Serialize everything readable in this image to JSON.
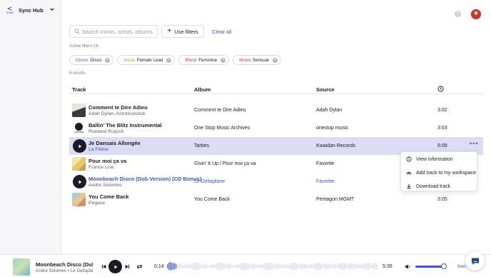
{
  "app": {
    "brand_small": "SYNC",
    "brand_name": "Sync Hub"
  },
  "search": {
    "placeholder": "Search tracks, artists, albums..."
  },
  "filters": {
    "use_filters_label": "Use filters",
    "clear_label": "Clear all",
    "active_label": "Active filters (4)"
  },
  "chips": [
    {
      "category": "Genre",
      "value": "Disco"
    },
    {
      "category": "Vocal",
      "value": "Female Lead"
    },
    {
      "category": "Mood",
      "value": "Feminine"
    },
    {
      "category": "Mood",
      "value": "Sensual"
    }
  ],
  "results_label": "6 results",
  "table": {
    "headers": {
      "track": "Track",
      "album": "Album",
      "source": "Source"
    },
    "rows": [
      {
        "title": "Comment te Dire Adieu",
        "artist": "Adah Dylan, Astroloveclub",
        "album": "Comment te Dire Adieu",
        "source": "Adah Dylan",
        "duration": "3:02"
      },
      {
        "title": "Ballin' The Blitz Instrumental",
        "artist": "Roeland Ruijsch",
        "album": "One Stop Music Archives",
        "source": "onestop music",
        "duration": "3:03",
        "thumb_text": "onestop"
      },
      {
        "title": "Je Dansais Allongée",
        "artist": "La Féline",
        "album": "Tarbes",
        "source": "Kwaidan Records",
        "duration": "5:09",
        "more": "•••"
      },
      {
        "title": "Pour moi ça va",
        "artist": "France Lise",
        "album": "Givin' It Up / Pour moi ça va",
        "source": "Favorite",
        "duration": ""
      },
      {
        "title": "Moonbeach Disco (Dub Version) (CD Bonus)",
        "artist": "Andre Solomko",
        "album": "Le Deltaplane",
        "source": "Favorite",
        "duration": ""
      },
      {
        "title": "You Come Back",
        "artist": "Pegase",
        "album": "You Come Back",
        "source": "Pentagon MGMT",
        "duration": "3:05"
      }
    ]
  },
  "context_menu": {
    "items": [
      {
        "label": "View information",
        "icon": "info-icon"
      },
      {
        "label": "Add track to my workspace",
        "icon": "workspace-icon"
      },
      {
        "label": "Download track",
        "icon": "download-icon"
      }
    ]
  },
  "player": {
    "title": "Moonbeach Disco (Dub Version) (CD Bonus)",
    "artist": "Andre Solomko • Le Deltaplane",
    "current_time": "0:14",
    "total_time": "5:35",
    "progress": 0.042,
    "volume": 0.9,
    "extra_label": "Non"
  },
  "colors": {
    "accent": "#3b52e8",
    "selected_row": "#dcdcf6",
    "genre": "#3b6fd8",
    "vocal": "#e2912a",
    "mood": "#d63b3b"
  }
}
